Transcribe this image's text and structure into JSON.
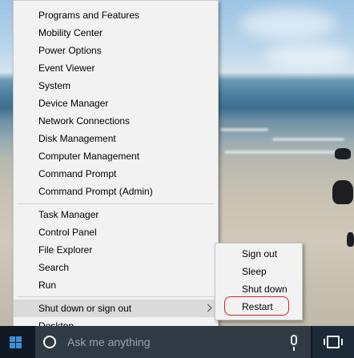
{
  "context_menu": {
    "group1": [
      "Programs and Features",
      "Mobility Center",
      "Power Options",
      "Event Viewer",
      "System",
      "Device Manager",
      "Network Connections",
      "Disk Management",
      "Computer Management",
      "Command Prompt",
      "Command Prompt (Admin)"
    ],
    "group2": [
      "Task Manager",
      "Control Panel",
      "File Explorer",
      "Search",
      "Run"
    ],
    "shutdown_label": "Shut down or sign out",
    "desktop_label": "Desktop"
  },
  "submenu": {
    "items": [
      "Sign out",
      "Sleep",
      "Shut down",
      "Restart"
    ],
    "highlighted_item": "Restart",
    "highlight_color": "#d21f2c"
  },
  "taskbar": {
    "search_placeholder": "Ask me anything",
    "start_icon": "windows-logo-icon",
    "search_icon": "cortana-circle-icon",
    "mic_icon": "microphone-icon",
    "task_view_icon": "task-view-icon",
    "accent_color": "#3b8fd8"
  }
}
